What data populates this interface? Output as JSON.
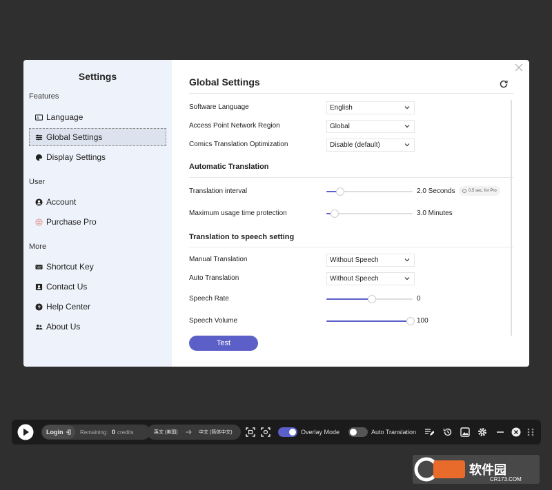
{
  "sidebar": {
    "title": "Settings",
    "sections": [
      "Features",
      "User",
      "More"
    ],
    "items": [
      {
        "label": "Language",
        "icon": "language-icon"
      },
      {
        "label": "Global Settings",
        "icon": "sliders-icon"
      },
      {
        "label": "Display Settings",
        "icon": "palette-icon"
      },
      {
        "label": "Account",
        "icon": "user-icon"
      },
      {
        "label": "Purchase Pro",
        "icon": "diamond-icon"
      },
      {
        "label": "Shortcut Key",
        "icon": "keyboard-icon"
      },
      {
        "label": "Contact Us",
        "icon": "contact-icon"
      },
      {
        "label": "Help Center",
        "icon": "help-icon"
      },
      {
        "label": "About Us",
        "icon": "users-icon"
      }
    ],
    "active_item": "Global Settings"
  },
  "main": {
    "title": "Global Settings",
    "general": {
      "language_label": "Software Language",
      "language_value": "English",
      "region_label": "Access Point Network Region",
      "region_value": "Global",
      "comics_label": "Comics Translation Optimization",
      "comics_value": "Disable (default)"
    },
    "auto": {
      "title": "Automatic Translation",
      "interval_label": "Translation interval",
      "interval_value": "2.0 Seconds",
      "interval_fraction": 0.15,
      "pro_hint": "0.5 sec. for Pro",
      "max_label": "Maximum usage time protection",
      "max_value": "3.0 Minutes",
      "max_fraction": 0.05
    },
    "speech": {
      "title": "Translation to speech setting",
      "manual_label": "Manual Translation",
      "manual_value": "Without Speech",
      "auto_label": "Auto Translation",
      "auto_value": "Without Speech",
      "rate_label": "Speech Rate",
      "rate_value": "0",
      "rate_fraction": 0.52,
      "volume_label": "Speech Volume",
      "volume_value": "100",
      "volume_fraction": 0.97
    },
    "test_label": "Test"
  },
  "toolbar": {
    "login_label": "Login",
    "remaining_label": "Remaining:",
    "remaining_count": "0",
    "credits_label": "credits",
    "source_lang": "英文 (美国)",
    "target_lang": "中文 (简体中文)",
    "overlay_label": "Overlay Mode",
    "overlay_on": true,
    "auto_label": "Auto Translation",
    "auto_on": false
  },
  "watermark": {
    "text": "软件园",
    "url_text": "CR173.COM"
  },
  "colors": {
    "accent": "#5b5fc7",
    "sidebar_bg": "#eef2fa",
    "toolbar_bg": "#1b1b1b"
  }
}
